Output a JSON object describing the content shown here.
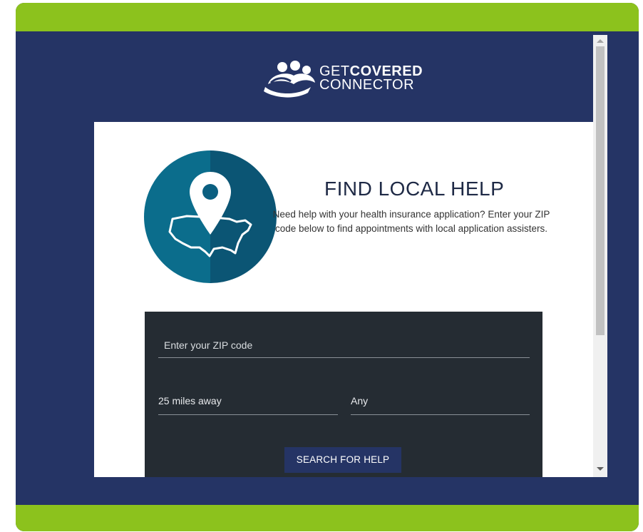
{
  "brand": {
    "line1_plain": "GET",
    "line1_bold": "COVERED",
    "line2": "CONNECTOR",
    "icon": "people-logo-icon"
  },
  "hero": {
    "title": "FIND LOCAL HELP",
    "description": "Need help with your health insurance application? Enter your ZIP code below to find appointments with local application assisters.",
    "icon": "location-pin-usa-map-icon"
  },
  "form": {
    "zip_placeholder": "Enter your ZIP code",
    "distance_value": "25 miles away",
    "type_value": "Any",
    "search_label": "SEARCH FOR HELP"
  },
  "colors": {
    "green_bar": "#8cc21d",
    "navy": "#253465",
    "panel_dark": "#252c33",
    "teal": "#0a6a8a"
  }
}
